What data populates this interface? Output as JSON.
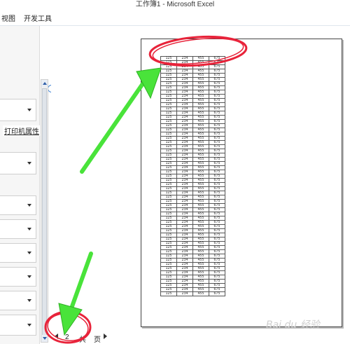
{
  "window": {
    "title": "工作簿1 - Microsoft Excel"
  },
  "ribbon": {
    "tabs": [
      "视图",
      "开发工具"
    ]
  },
  "settings": {
    "printer_properties_label": "打印机属性"
  },
  "pager": {
    "current_page": "2",
    "total_label_prefix": "共",
    "total_label_suffix": "页"
  },
  "sheet": {
    "row_values": [
      "125",
      "234",
      "455",
      "675"
    ],
    "row_count": 57
  },
  "colors": {
    "annotation_green": "#49e33a",
    "annotation_red": "#e8233a"
  },
  "watermark": "Bai du 经验"
}
